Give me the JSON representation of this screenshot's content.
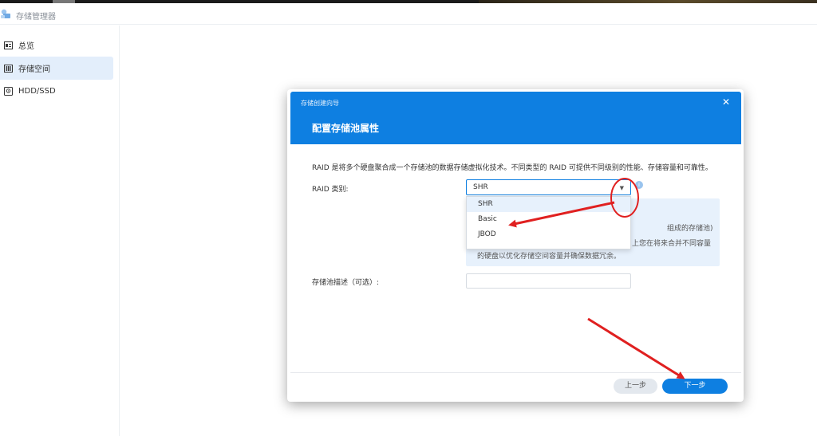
{
  "app": {
    "title": "存储管理器"
  },
  "sidebar": {
    "items": [
      {
        "label": "总览",
        "icon": "overview-icon"
      },
      {
        "label": "存储空间",
        "icon": "storage-icon"
      },
      {
        "label": "HDD/SSD",
        "icon": "disk-icon"
      }
    ],
    "active_index": 1
  },
  "dialog": {
    "wizard_title": "存储创建向导",
    "step_title": "配置存储池属性",
    "close_icon": "close-icon",
    "description": "RAID 是将多个硬盘聚合成一个存储池的数据存储虚拟化技术。不同类型的 RAID 可提供不同级别的性能、存储容量和可靠性。",
    "raid_label": "RAID 类别:",
    "raid_selected": "SHR",
    "raid_options": [
      "SHR",
      "Basic",
      "JBOD"
    ],
    "info_lines": [
      "组成的存储池)",
      "上您在将来合并不同容量",
      "的硬盘以优化存储空间容量并确保数据冗余。"
    ],
    "pool_desc_label": "存储池描述（可选）:",
    "pool_desc_value": "",
    "prev_button": "上一步",
    "next_button": "下一步"
  },
  "colors": {
    "accent": "#0e7fe1",
    "annotation": "#e02020"
  }
}
